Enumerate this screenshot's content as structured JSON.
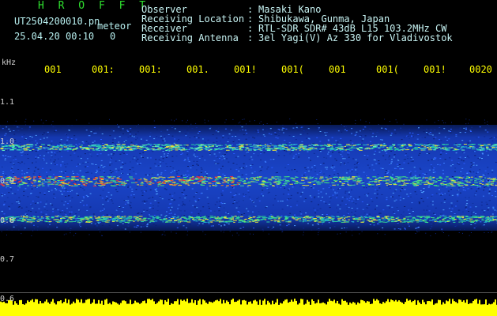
{
  "header": {
    "brand": "H R O F F T",
    "filename": "UT2504200010.pn",
    "meteor_label": "meteor",
    "datetime": "25.04.20 00:10",
    "meteor_count": "0"
  },
  "info": [
    {
      "label": "Observer",
      "value": "Masaki Kano"
    },
    {
      "label": "Receiving Location",
      "value": "Shibukawa, Gunma, Japan"
    },
    {
      "label": "Receiver",
      "value": "RTL-SDR SDR# 43dB L15 103.2MHz CW"
    },
    {
      "label": "Receiving Antenna",
      "value": "3el Yagi(V) Az 330 for Vladivostok"
    }
  ],
  "axis": {
    "unit": "kHz",
    "y_ticks": [
      "1.1",
      "1.0",
      "0.9",
      "0.8",
      "0.7",
      "0.6"
    ],
    "x_ticks": [
      "001",
      "001:",
      "001:",
      "001.",
      "001!",
      "001(",
      "001",
      "001(",
      "001!",
      "0020"
    ]
  },
  "colors": {
    "background": "#000000",
    "noise_band": "#1e5cff",
    "baseline_signal": "#ffff00",
    "brand": "#2fe02f",
    "text": "#c8f4f4"
  }
}
